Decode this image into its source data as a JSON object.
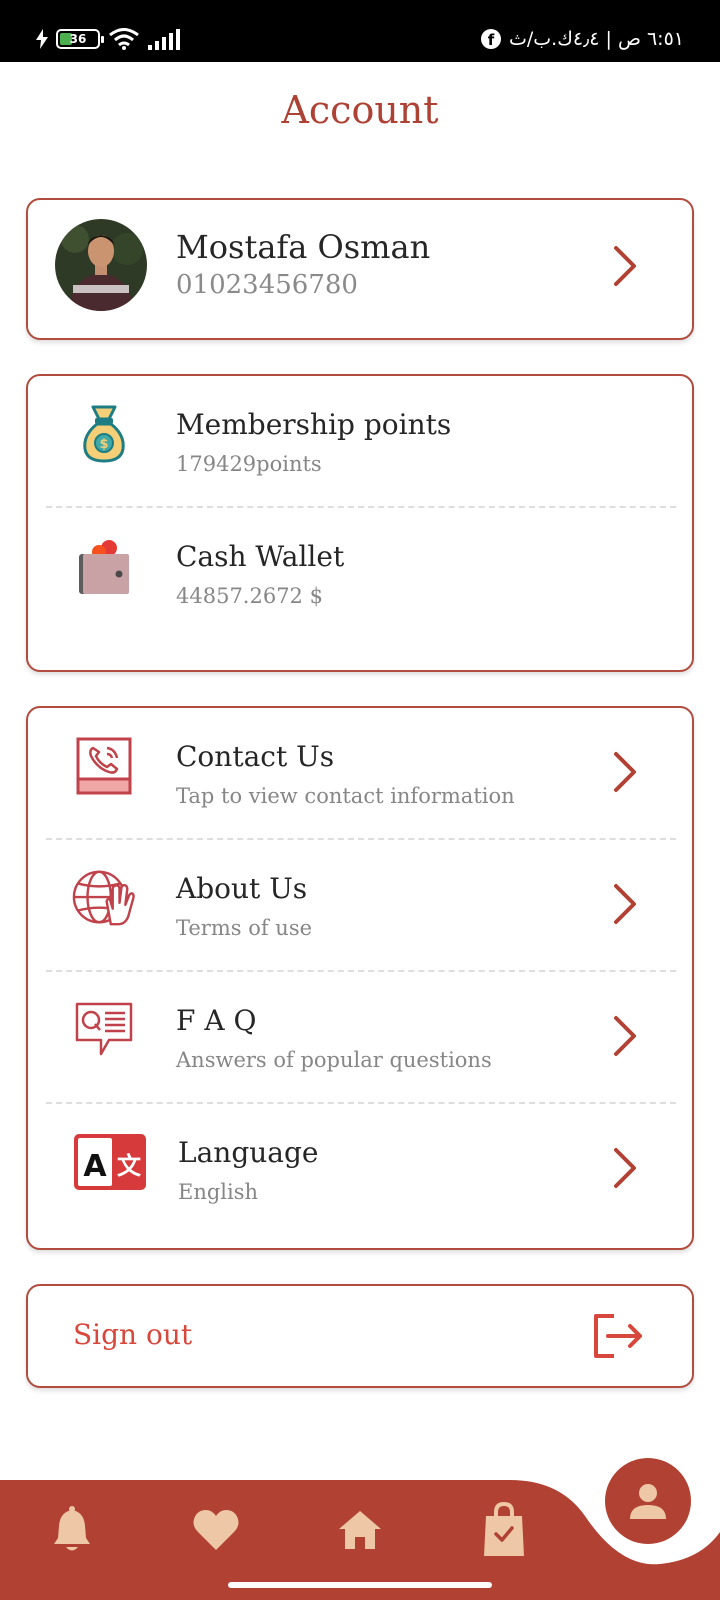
{
  "status_bar": {
    "battery_level": "36",
    "time_text": "٦:٥١ ص | ٤٫٤ك.ب/ث"
  },
  "header": {
    "title": "Account"
  },
  "profile": {
    "name": "Mostafa Osman",
    "phone": "01023456780"
  },
  "wallet": {
    "points_title": "Membership points",
    "points_value": "179429points",
    "cash_title": "Cash Wallet",
    "cash_value": "44857.2672 $"
  },
  "menu": {
    "items": [
      {
        "title": "Contact Us",
        "subtitle": "Tap to view contact information",
        "icon": "phone-contact-icon"
      },
      {
        "title": "About Us",
        "subtitle": "Terms of use",
        "icon": "globe-hand-icon"
      },
      {
        "title": "F A Q",
        "subtitle": "Answers of popular questions",
        "icon": "faq-bubble-icon"
      },
      {
        "title": "Language",
        "subtitle": "English",
        "icon": "translate-icon"
      }
    ]
  },
  "signout": {
    "label": "Sign out"
  },
  "nav": {
    "items": [
      "bell-icon",
      "heart-icon",
      "home-icon",
      "shopping-bag-icon",
      "user-icon"
    ],
    "active": "user-icon"
  },
  "colors": {
    "accent": "#ad4234",
    "border": "#b24c3f",
    "nav_background": "#b14233",
    "nav_icon": "#edc7a6",
    "signout": "#d8473c"
  }
}
